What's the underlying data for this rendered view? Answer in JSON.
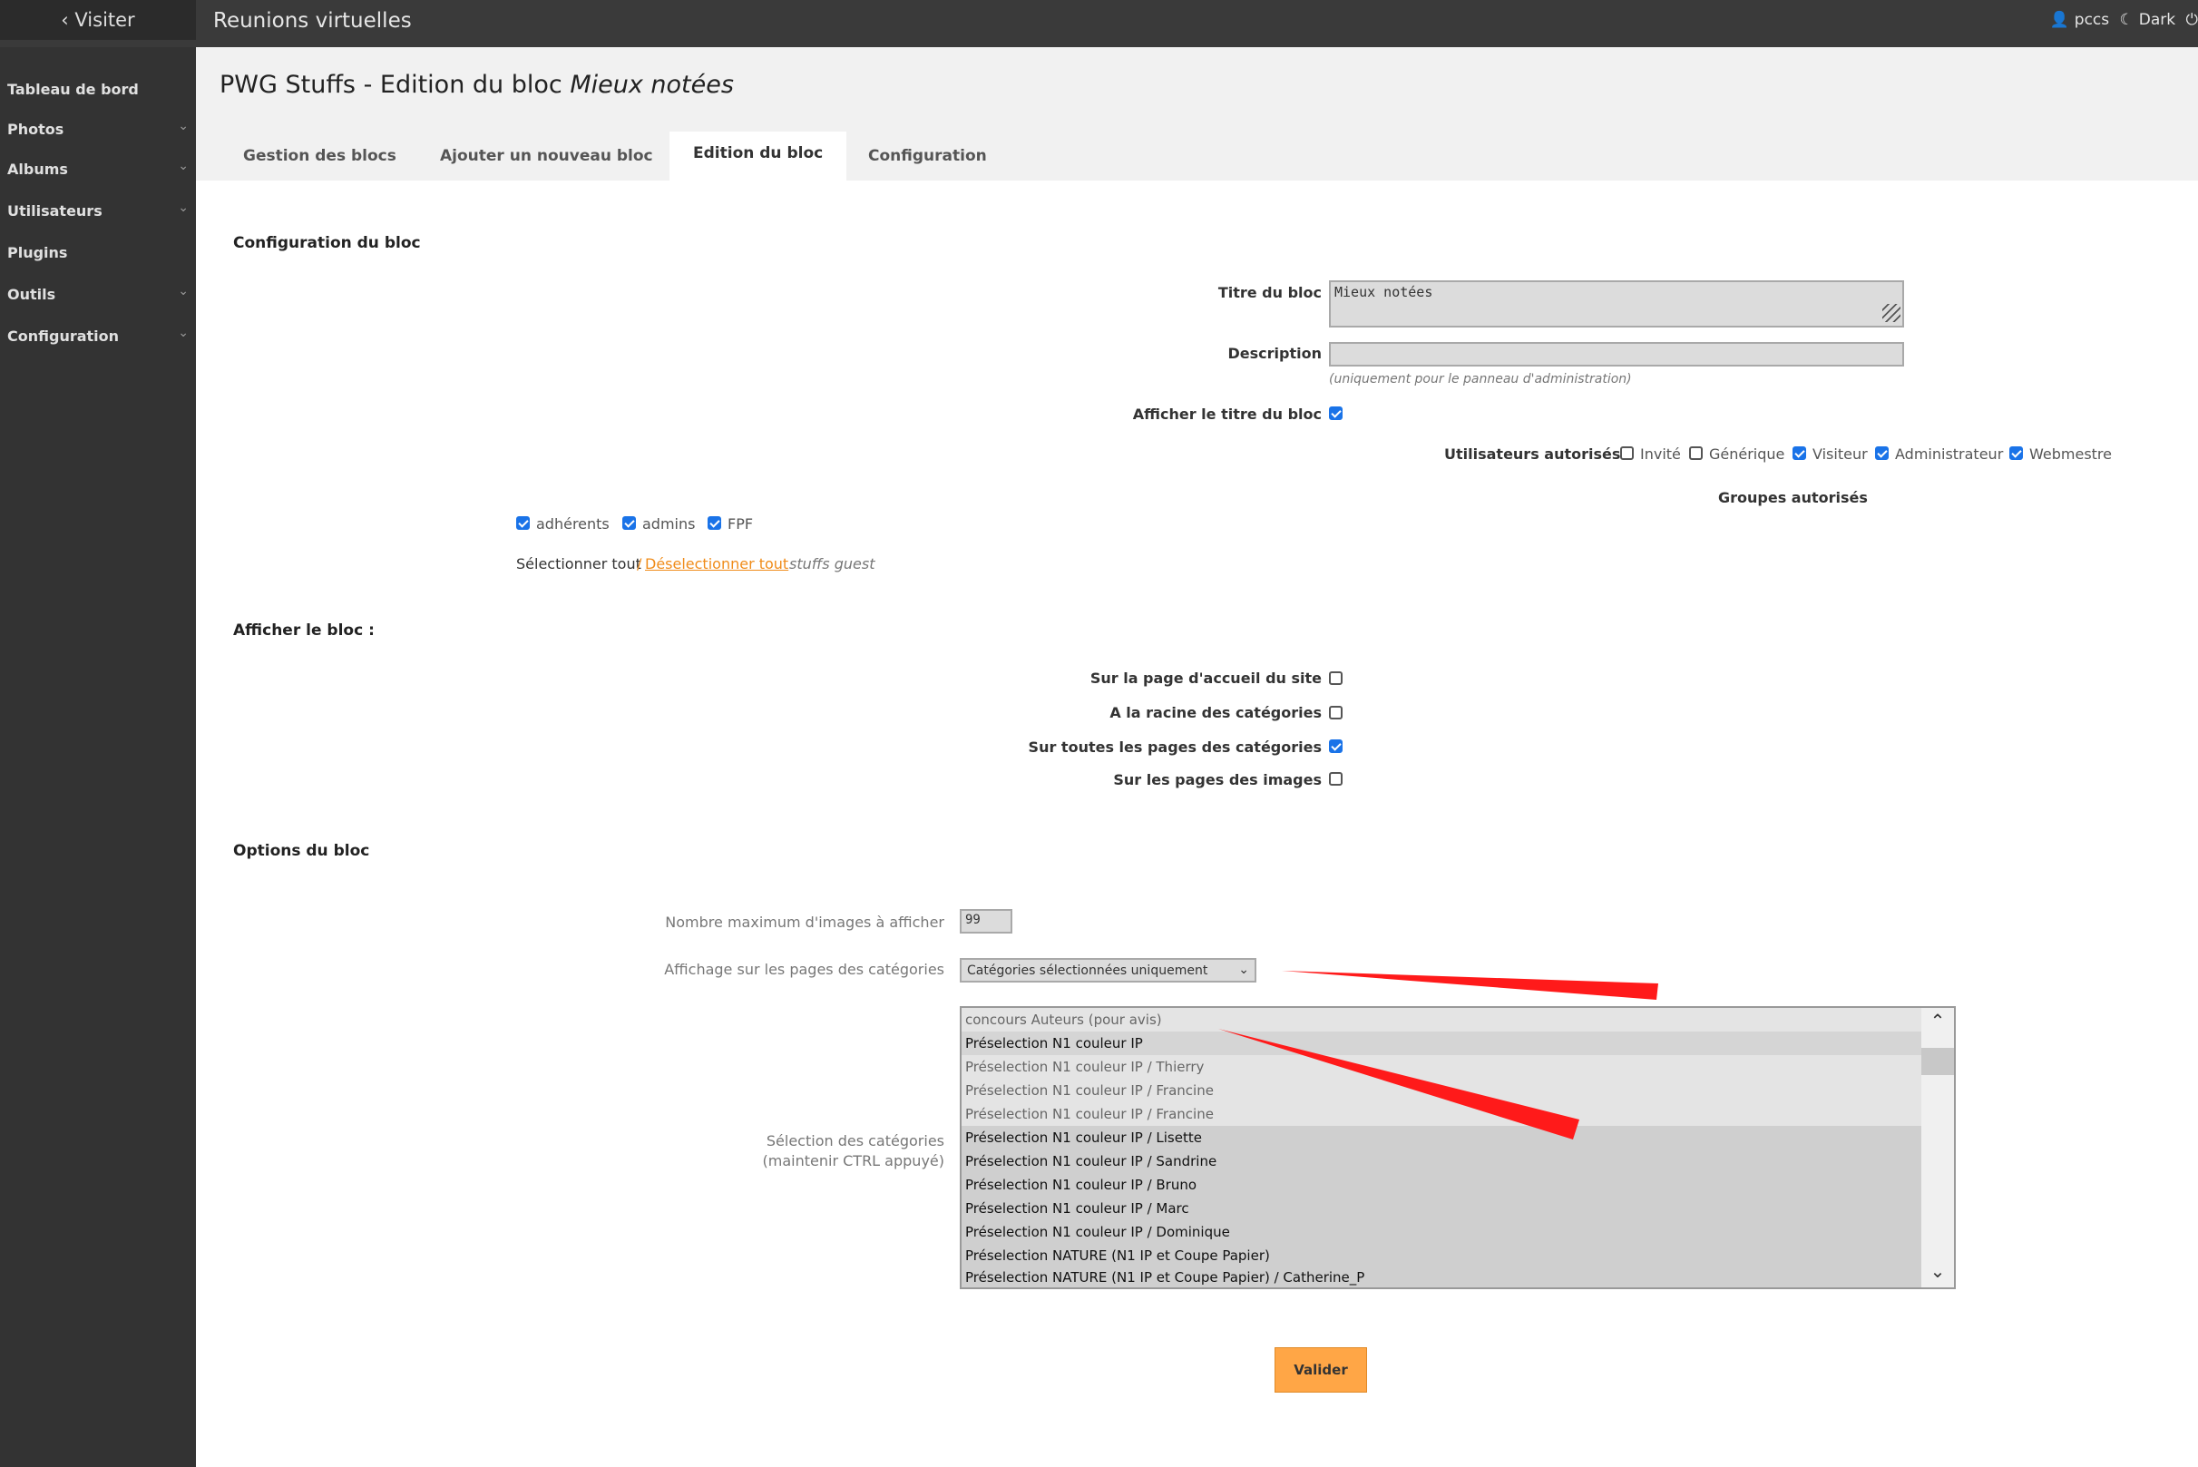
{
  "topbar": {
    "visit_label": "Visiter",
    "site_title": "Reunions virtuelles",
    "user": "pccs",
    "theme": "Dark"
  },
  "sidebar": {
    "items": [
      {
        "label": "Tableau de bord",
        "has_submenu": false
      },
      {
        "label": "Photos",
        "has_submenu": true
      },
      {
        "label": "Albums",
        "has_submenu": true
      },
      {
        "label": "Utilisateurs",
        "has_submenu": true
      },
      {
        "label": "Plugins",
        "has_submenu": false
      },
      {
        "label": "Outils",
        "has_submenu": true
      },
      {
        "label": "Configuration",
        "has_submenu": true
      }
    ]
  },
  "header": {
    "title_prefix": "PWG Stuffs - Edition du bloc",
    "title_block": "Mieux notées",
    "tabs": [
      {
        "label": "Gestion des blocs",
        "active": false
      },
      {
        "label": "Ajouter un nouveau bloc",
        "active": false
      },
      {
        "label": "Edition du bloc",
        "active": true
      },
      {
        "label": "Configuration",
        "active": false
      }
    ]
  },
  "config_section": {
    "title": "Configuration du bloc",
    "title_label": "Titre du bloc",
    "title_value": "Mieux notées",
    "description_label": "Description",
    "description_value": "",
    "description_hint": "(uniquement pour le panneau d'administration)",
    "show_title_label": "Afficher le titre du bloc",
    "show_title_checked": true,
    "users_label": "Utilisateurs autorisés",
    "users": [
      {
        "label": "Invité",
        "checked": false
      },
      {
        "label": "Générique",
        "checked": false
      },
      {
        "label": "Visiteur",
        "checked": true
      },
      {
        "label": "Administrateur",
        "checked": true
      },
      {
        "label": "Webmestre",
        "checked": true
      }
    ],
    "groups_label": "Groupes autorisés",
    "groups": [
      {
        "label": "adhérents",
        "checked": true
      },
      {
        "label": "admins",
        "checked": true
      },
      {
        "label": "FPF",
        "checked": true
      }
    ],
    "select_all": "Sélectionner tout",
    "separator": "/",
    "deselect_all": "Déselectionner tout",
    "group_note": "stuffs guest"
  },
  "display_section": {
    "title": "Afficher le bloc :",
    "options": [
      {
        "label": "Sur la page d'accueil du site",
        "checked": false
      },
      {
        "label": "A la racine des catégories",
        "checked": false
      },
      {
        "label": "Sur toutes les pages des catégories",
        "checked": true
      },
      {
        "label": "Sur les pages des images",
        "checked": false
      }
    ]
  },
  "options_section": {
    "title": "Options du bloc",
    "max_images_label": "Nombre maximum d'images à afficher",
    "max_images_value": "99",
    "display_label": "Affichage sur les pages des catégories",
    "display_value": "Catégories sélectionnées uniquement",
    "categories_label": "Sélection des catégories",
    "categories_hint": "(maintenir CTRL appuyé)",
    "categories": [
      {
        "label": "concours Auteurs (pour avis)",
        "selected": false
      },
      {
        "label": "Préselection N1 couleur IP",
        "selected": true
      },
      {
        "label": "Préselection N1 couleur IP / Thierry",
        "selected": false
      },
      {
        "label": "Préselection N1 couleur IP / Francine",
        "selected": false
      },
      {
        "label": "Préselection N1 couleur IP / Francine",
        "selected": false
      },
      {
        "label": "Préselection N1 couleur IP / Lisette",
        "selected": true
      },
      {
        "label": "Préselection N1 couleur IP / Sandrine",
        "selected": true
      },
      {
        "label": "Préselection N1 couleur IP / Bruno",
        "selected": true
      },
      {
        "label": "Préselection N1 couleur IP / Marc",
        "selected": true
      },
      {
        "label": "Préselection N1 couleur IP / Dominique",
        "selected": true
      },
      {
        "label": "Préselection NATURE (N1 IP et Coupe Papier)",
        "selected": true
      },
      {
        "label": "Préselection NATURE (N1 IP et Coupe Papier) / Catherine_P",
        "selected": true
      }
    ]
  },
  "submit_label": "Valider",
  "colors": {
    "accent": "#ffa646",
    "link": "#f08c1a",
    "annotation": "#ff1a1a"
  }
}
